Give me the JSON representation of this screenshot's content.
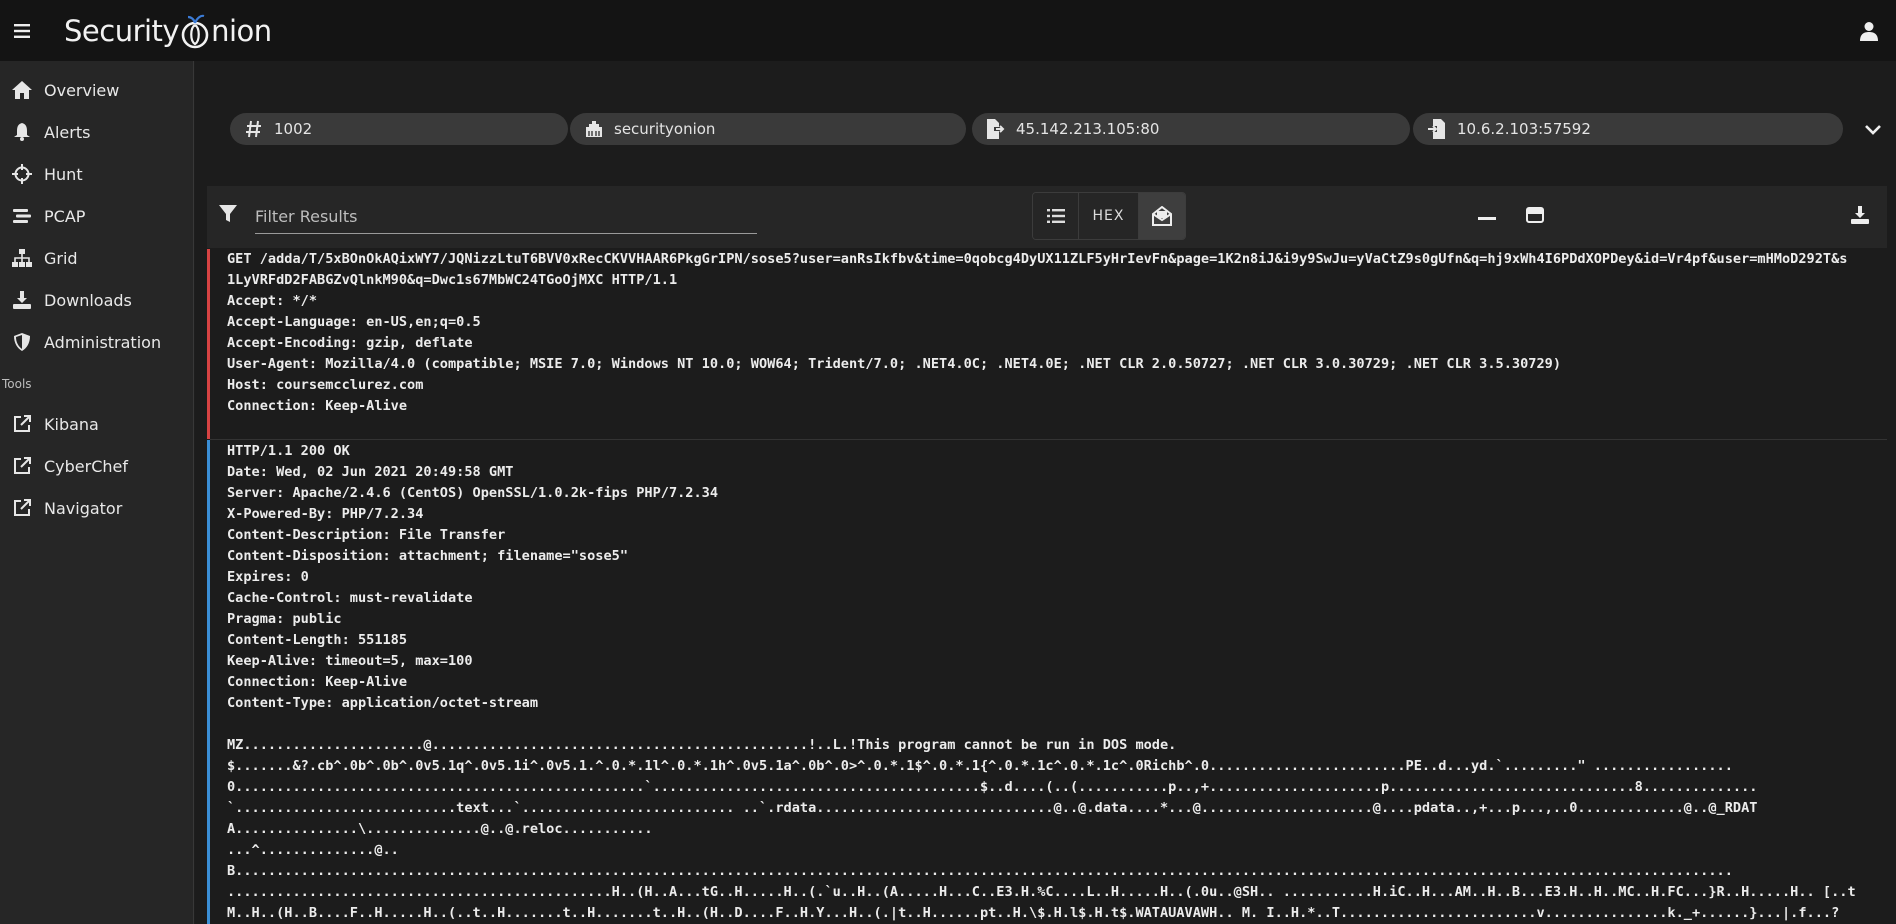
{
  "app": {
    "brand_left": "Security",
    "brand_right": "nion"
  },
  "sidebar": {
    "items": [
      {
        "label": "Overview",
        "icon": "home-icon"
      },
      {
        "label": "Alerts",
        "icon": "bell-icon"
      },
      {
        "label": "Hunt",
        "icon": "crosshairs-icon"
      },
      {
        "label": "PCAP",
        "icon": "stream-icon"
      },
      {
        "label": "Grid",
        "icon": "sitemap-icon"
      },
      {
        "label": "Downloads",
        "icon": "download-icon"
      },
      {
        "label": "Administration",
        "icon": "shield-icon"
      }
    ],
    "tools_label": "Tools",
    "tools": [
      {
        "label": "Kibana",
        "icon": "external-link-icon"
      },
      {
        "label": "CyberChef",
        "icon": "external-link-icon"
      },
      {
        "label": "Navigator",
        "icon": "external-link-icon"
      }
    ]
  },
  "chips": {
    "id": "1002",
    "sensor": "securityonion",
    "source": "45.142.213.105:80",
    "destination": "10.6.2.103:57592"
  },
  "toolbar": {
    "filter_placeholder": "Filter Results",
    "hex_label": "HEX"
  },
  "request_lines": [
    "GET /adda/T/5xBOnOkAQixWY7/JQNizzLtuT6BVV0xRecCKVVHAAR6PkgGrIPN/sose5?user=anRsIkfbv&time=0qobcg4DyUX11ZLF5yHrIevFn&page=1K2n8iJ&i9y9SwJu=yVaCtZ9s0gUfn&q=hj9xWh4I6PDdXOPDey&id=Vr4pf&user=mHMoD292T&s",
    "1LyVRFdD2FABGZvQlnkM90&q=Dwc1s67MbWC24TGoOjMXC HTTP/1.1",
    "Accept: */*",
    "Accept-Language: en-US,en;q=0.5",
    "Accept-Encoding: gzip, deflate",
    "User-Agent: Mozilla/4.0 (compatible; MSIE 7.0; Windows NT 10.0; WOW64; Trident/7.0; .NET4.0C; .NET4.0E; .NET CLR 2.0.50727; .NET CLR 3.0.30729; .NET CLR 3.5.30729)",
    "Host: coursemcclurez.com",
    "Connection: Keep-Alive"
  ],
  "response_headers": [
    "HTTP/1.1 200 OK",
    "Date: Wed, 02 Jun 2021 20:49:58 GMT",
    "Server: Apache/2.4.6 (CentOS) OpenSSL/1.0.2k-fips PHP/7.2.34",
    "X-Powered-By: PHP/7.2.34",
    "Content-Description: File Transfer",
    "Content-Disposition: attachment; filename=\"sose5\"",
    "Expires: 0",
    "Cache-Control: must-revalidate",
    "Pragma: public",
    "Content-Length: 551185",
    "Keep-Alive: timeout=5, max=100",
    "Connection: Keep-Alive",
    "Content-Type: application/octet-stream"
  ],
  "response_body": [
    "MZ......................@..............................................!..L.!This program cannot be run in DOS mode.",
    "$.......&?.cb^.0b^.0b^.0v5.1q^.0v5.1i^.0v5.1.^.0.*.1l^.0.*.1h^.0v5.1a^.0b^.0>^.0.*.1$^.0.*.1{^.0.*.1c^.0.*.1c^.0Richb^.0........................PE..d...yd.`.........\" .................",
    "0..................................................`........................................$..d....(..(...........p..,+.....................p..............................8..............",
    "`...........................text...`.......................... ..`.rdata.............................@..@.data....*...@.....................@....pdata..,+...p...,..0.............@..@_RDAT",
    "A...............\\..............@..@.reloc...........",
    "...^..............@..",
    "B.......................................................................................................................................................................................",
    "...............................................H..(H..A...tG..H.....H..(.`u..H..(A.....H...C..E3.H.%C....L..H.....H..(.0u..@SH.. ...........H.iC..H...AM..H..B...E3.H..H..MC..H.FC...}R..H.....H.. [..t",
    "M..H..(H..B....F..H.....H..(..t..H.......t..H.......t..H..(H..D....F..H.Y...H..(.|t..H......pt..H.\\$.H.l$.H.t$.WATAUAVAWH.. M. I..H.*..T........................v...............k._+......}...|.f...?"
  ]
}
